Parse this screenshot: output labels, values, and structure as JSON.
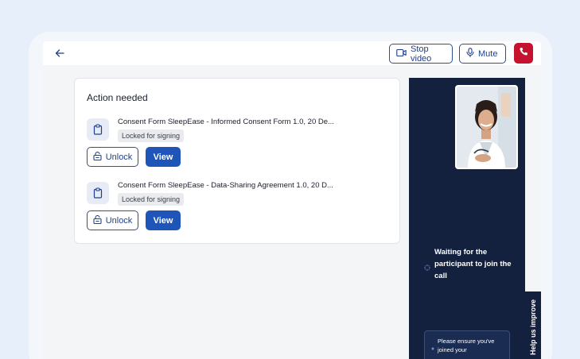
{
  "header": {
    "stop_video_label": "Stop video",
    "mute_label": "Mute"
  },
  "action_card": {
    "title": "Action needed",
    "documents": [
      {
        "title": "Consent Form SleepEase - Informed Consent Form 1.0, 20 De...",
        "status": "Locked for signing",
        "unlock_label": "Unlock",
        "view_label": "View"
      },
      {
        "title": "Consent Form SleepEase - Data-Sharing Agreement 1.0, 20 D...",
        "status": "Locked for signing",
        "unlock_label": "Unlock",
        "view_label": "View"
      }
    ]
  },
  "call_panel": {
    "waiting_text": "Waiting for the participant to join the call",
    "tip_text": "Please ensure you've joined your"
  },
  "help_tab": {
    "label": "Help us improve"
  },
  "colors": {
    "primary": "#1f55b8",
    "end_call": "#c4122f",
    "panel": "#13213f"
  }
}
